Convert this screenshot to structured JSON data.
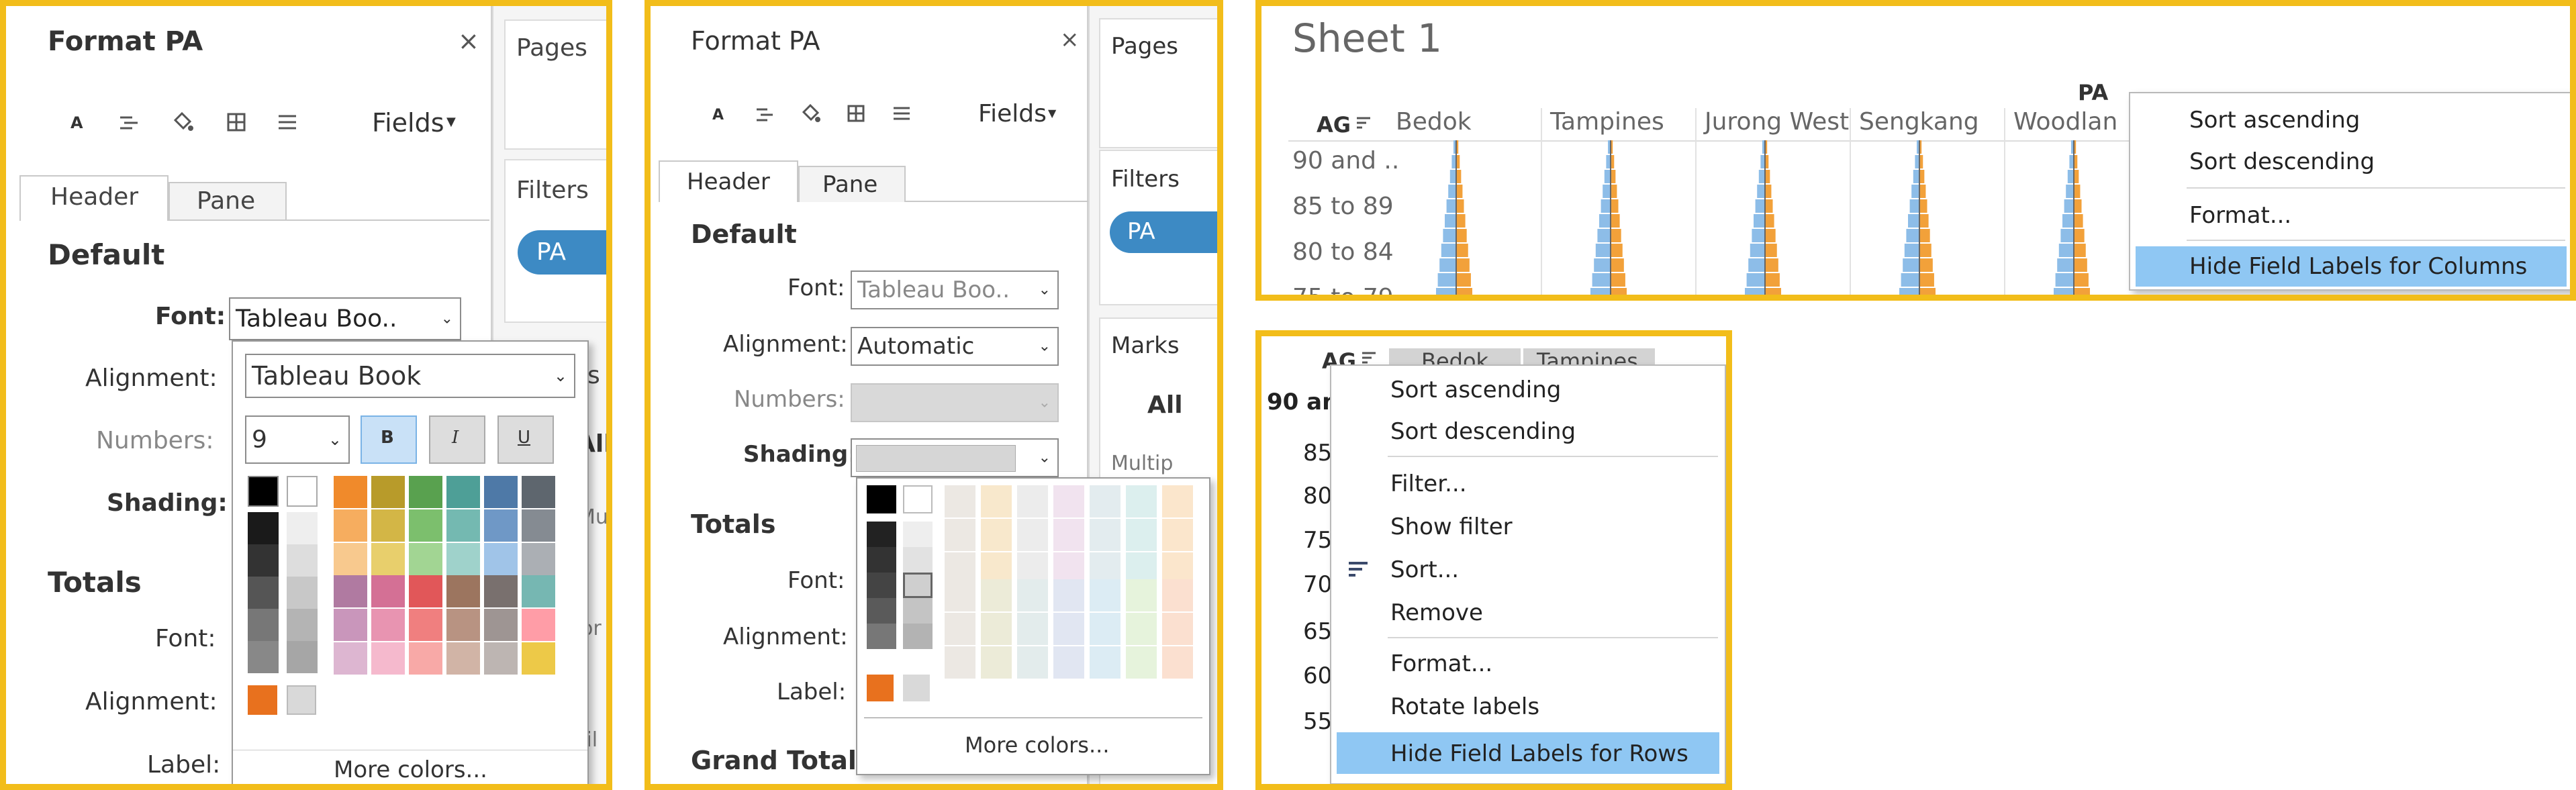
{
  "panel1": {
    "title": "Format PA",
    "close": "×",
    "fields_label": "Fields",
    "tabs": [
      "Header",
      "Pane"
    ],
    "default_heading": "Default",
    "font_label": "Font:",
    "font_value": "Tableau Boo..",
    "alignment_label": "Alignment:",
    "numbers_label": "Numbers:",
    "shading_label": "Shading:",
    "totals_heading": "Totals",
    "totals_font_label": "Font:",
    "totals_alignment_label": "Alignment:",
    "label_label": "Label:",
    "font_popup": {
      "font_name": "Tableau Book",
      "size": "9",
      "bold": "B",
      "italic": "I",
      "underline": "U",
      "more_colors": "More colors..."
    },
    "side": {
      "pages": "Pages",
      "filters": "Filters",
      "pill": "PA",
      "s_fragment": "s",
      "all_fragment": "All",
      "mul_fragment": "Mul",
      "or_fragment": "or",
      "ail_fragment": "ail"
    }
  },
  "panel2": {
    "title": "Format PA",
    "close": "×",
    "fields_label": "Fields",
    "tabs": [
      "Header",
      "Pane"
    ],
    "default_heading": "Default",
    "font_label": "Font:",
    "font_value": "Tableau Boo..",
    "alignment_label": "Alignment:",
    "alignment_value": "Automatic",
    "numbers_label": "Numbers:",
    "shading_label": "Shading:",
    "totals_heading": "Totals",
    "totals_font_label": "Font:",
    "totals_alignment_label": "Alignment:",
    "label_label": "Label:",
    "grand_totals_heading": "Grand Totals",
    "more_colors": "More colors...",
    "side": {
      "pages": "Pages",
      "filters": "Filters",
      "pill": "PA",
      "marks": "Marks",
      "all": "All",
      "multip": "Multip",
      "ul_fragment": "ul"
    }
  },
  "panel3": {
    "sheet_title": "Sheet 1",
    "pa_label": "PA",
    "ag_label": "AG",
    "columns": [
      "Bedok",
      "Tampines",
      "Jurong West",
      "Sengkang",
      "Woodlan"
    ],
    "rows": [
      "90 and ..",
      "85 to 89",
      "80 to 84",
      "75 to 79"
    ],
    "menu": [
      "Sort ascending",
      "Sort descending",
      "Format...",
      "Hide Field Labels for Columns"
    ]
  },
  "panel4": {
    "ag_label": "AG",
    "columns": [
      "Bedok",
      "Tampines"
    ],
    "row_fragments": [
      "90 and",
      "85",
      "80",
      "75",
      "70",
      "65",
      "60",
      "55"
    ],
    "menu": [
      "Sort ascending",
      "Sort descending",
      "Filter...",
      "Show filter",
      "Sort...",
      "Remove",
      "Format...",
      "Rotate labels",
      "Hide Field Labels for Rows"
    ]
  },
  "colors": {
    "accent_border": "#f2bd1a",
    "highlight": "#8fc7f3",
    "pill": "#3d8ac4",
    "bar_blue": "#8dbde8",
    "bar_orange": "#f2a13a"
  }
}
